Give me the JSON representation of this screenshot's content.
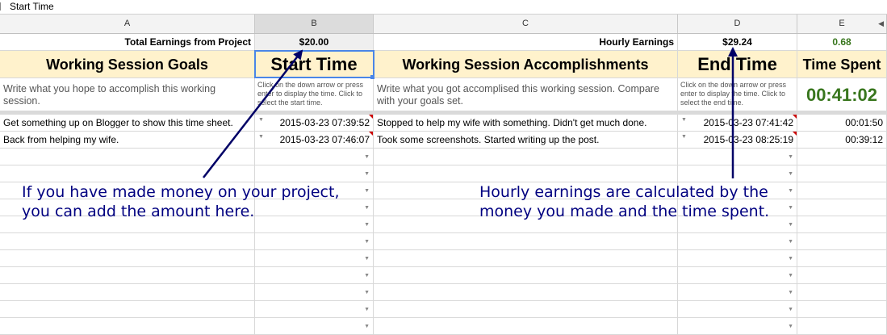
{
  "formula_bar": {
    "value": "Start Time"
  },
  "columns": [
    "A",
    "B",
    "C",
    "D",
    "E"
  ],
  "summary_row": {
    "total_earnings_label": "Total Earnings from Project",
    "total_earnings_value": "$20.00",
    "hourly_earnings_label": "Hourly Earnings",
    "hourly_earnings_value": "$29.24",
    "ratio_value": "0.68"
  },
  "header_row": {
    "goals": "Working Session Goals",
    "start_time": "Start Time",
    "accomplishments": "Working Session Accomplishments",
    "end_time": "End Time",
    "time_spent": "Time Spent"
  },
  "instructions_row": {
    "goals": "Write what you hope to accomplish this working session.",
    "start_time": "Click on the down arrow or press enter to display the time. Click to select the start time.",
    "accomplishments": "Write what you got accomplised this working session. Compare with your goals set.",
    "end_time": "Click on the down arrow or press enter to display the time. Click to select the end time.",
    "total_time": "00:41:02"
  },
  "rows": [
    {
      "goal": "Get something up on Blogger to show this time sheet.",
      "start": "2015-03-23 07:39:52",
      "accomplishment": "Stopped to help my wife with something. Didn't get much done.",
      "end": "2015-03-23 07:41:42",
      "spent": "00:01:50"
    },
    {
      "goal": "Back from helping my wife.",
      "start": "2015-03-23 07:46:07",
      "accomplishment": "Took some screenshots. Started writing up the post.",
      "end": "2015-03-23 08:25:19",
      "spent": "00:39:12"
    }
  ],
  "annotations": {
    "left_line1": "If you have made money on your project,",
    "left_line2": "you can add the amount here.",
    "right_line1": "Hourly earnings are calculated by the",
    "right_line2": "money you made and the time spent."
  },
  "colors": {
    "header_fill": "#fff2cc",
    "timer_green": "#38761d",
    "ratio_green": "#38761d",
    "annotation_navy": "#000080",
    "selection_blue": "#4a86e8"
  }
}
